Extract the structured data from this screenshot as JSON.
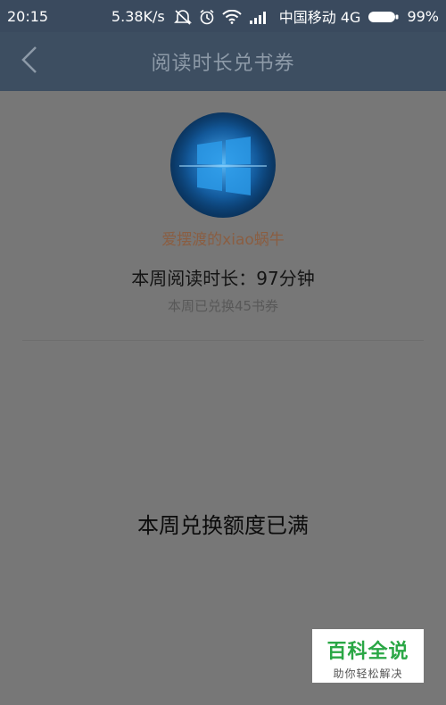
{
  "status_bar": {
    "time": "20:15",
    "speed": "5.38K/s",
    "carrier": "中国移动 4G",
    "battery": "99%",
    "icons": [
      "mute-icon",
      "alarm-icon",
      "wifi-icon",
      "signal-icon",
      "battery-icon"
    ]
  },
  "header": {
    "title": "阅读时长兑书券",
    "back_icon": "chevron-left-icon"
  },
  "profile": {
    "avatar_icon": "windows-logo-avatar",
    "username": "爱摆渡的xiao蜗牛",
    "reading_time": "本周阅读时长：97分钟",
    "exchanged": "本周已兑换45书券"
  },
  "main": {
    "quota_message": "本周兑换额度已满"
  },
  "watermark": {
    "title": "百科全说",
    "subtitle": "助你轻松解决"
  },
  "colors": {
    "status_bar": "#3a4a5e",
    "header": "#3d4e61",
    "overlay_background": "#777777",
    "username": "#8a5e42",
    "watermark_green": "#2aa745"
  }
}
